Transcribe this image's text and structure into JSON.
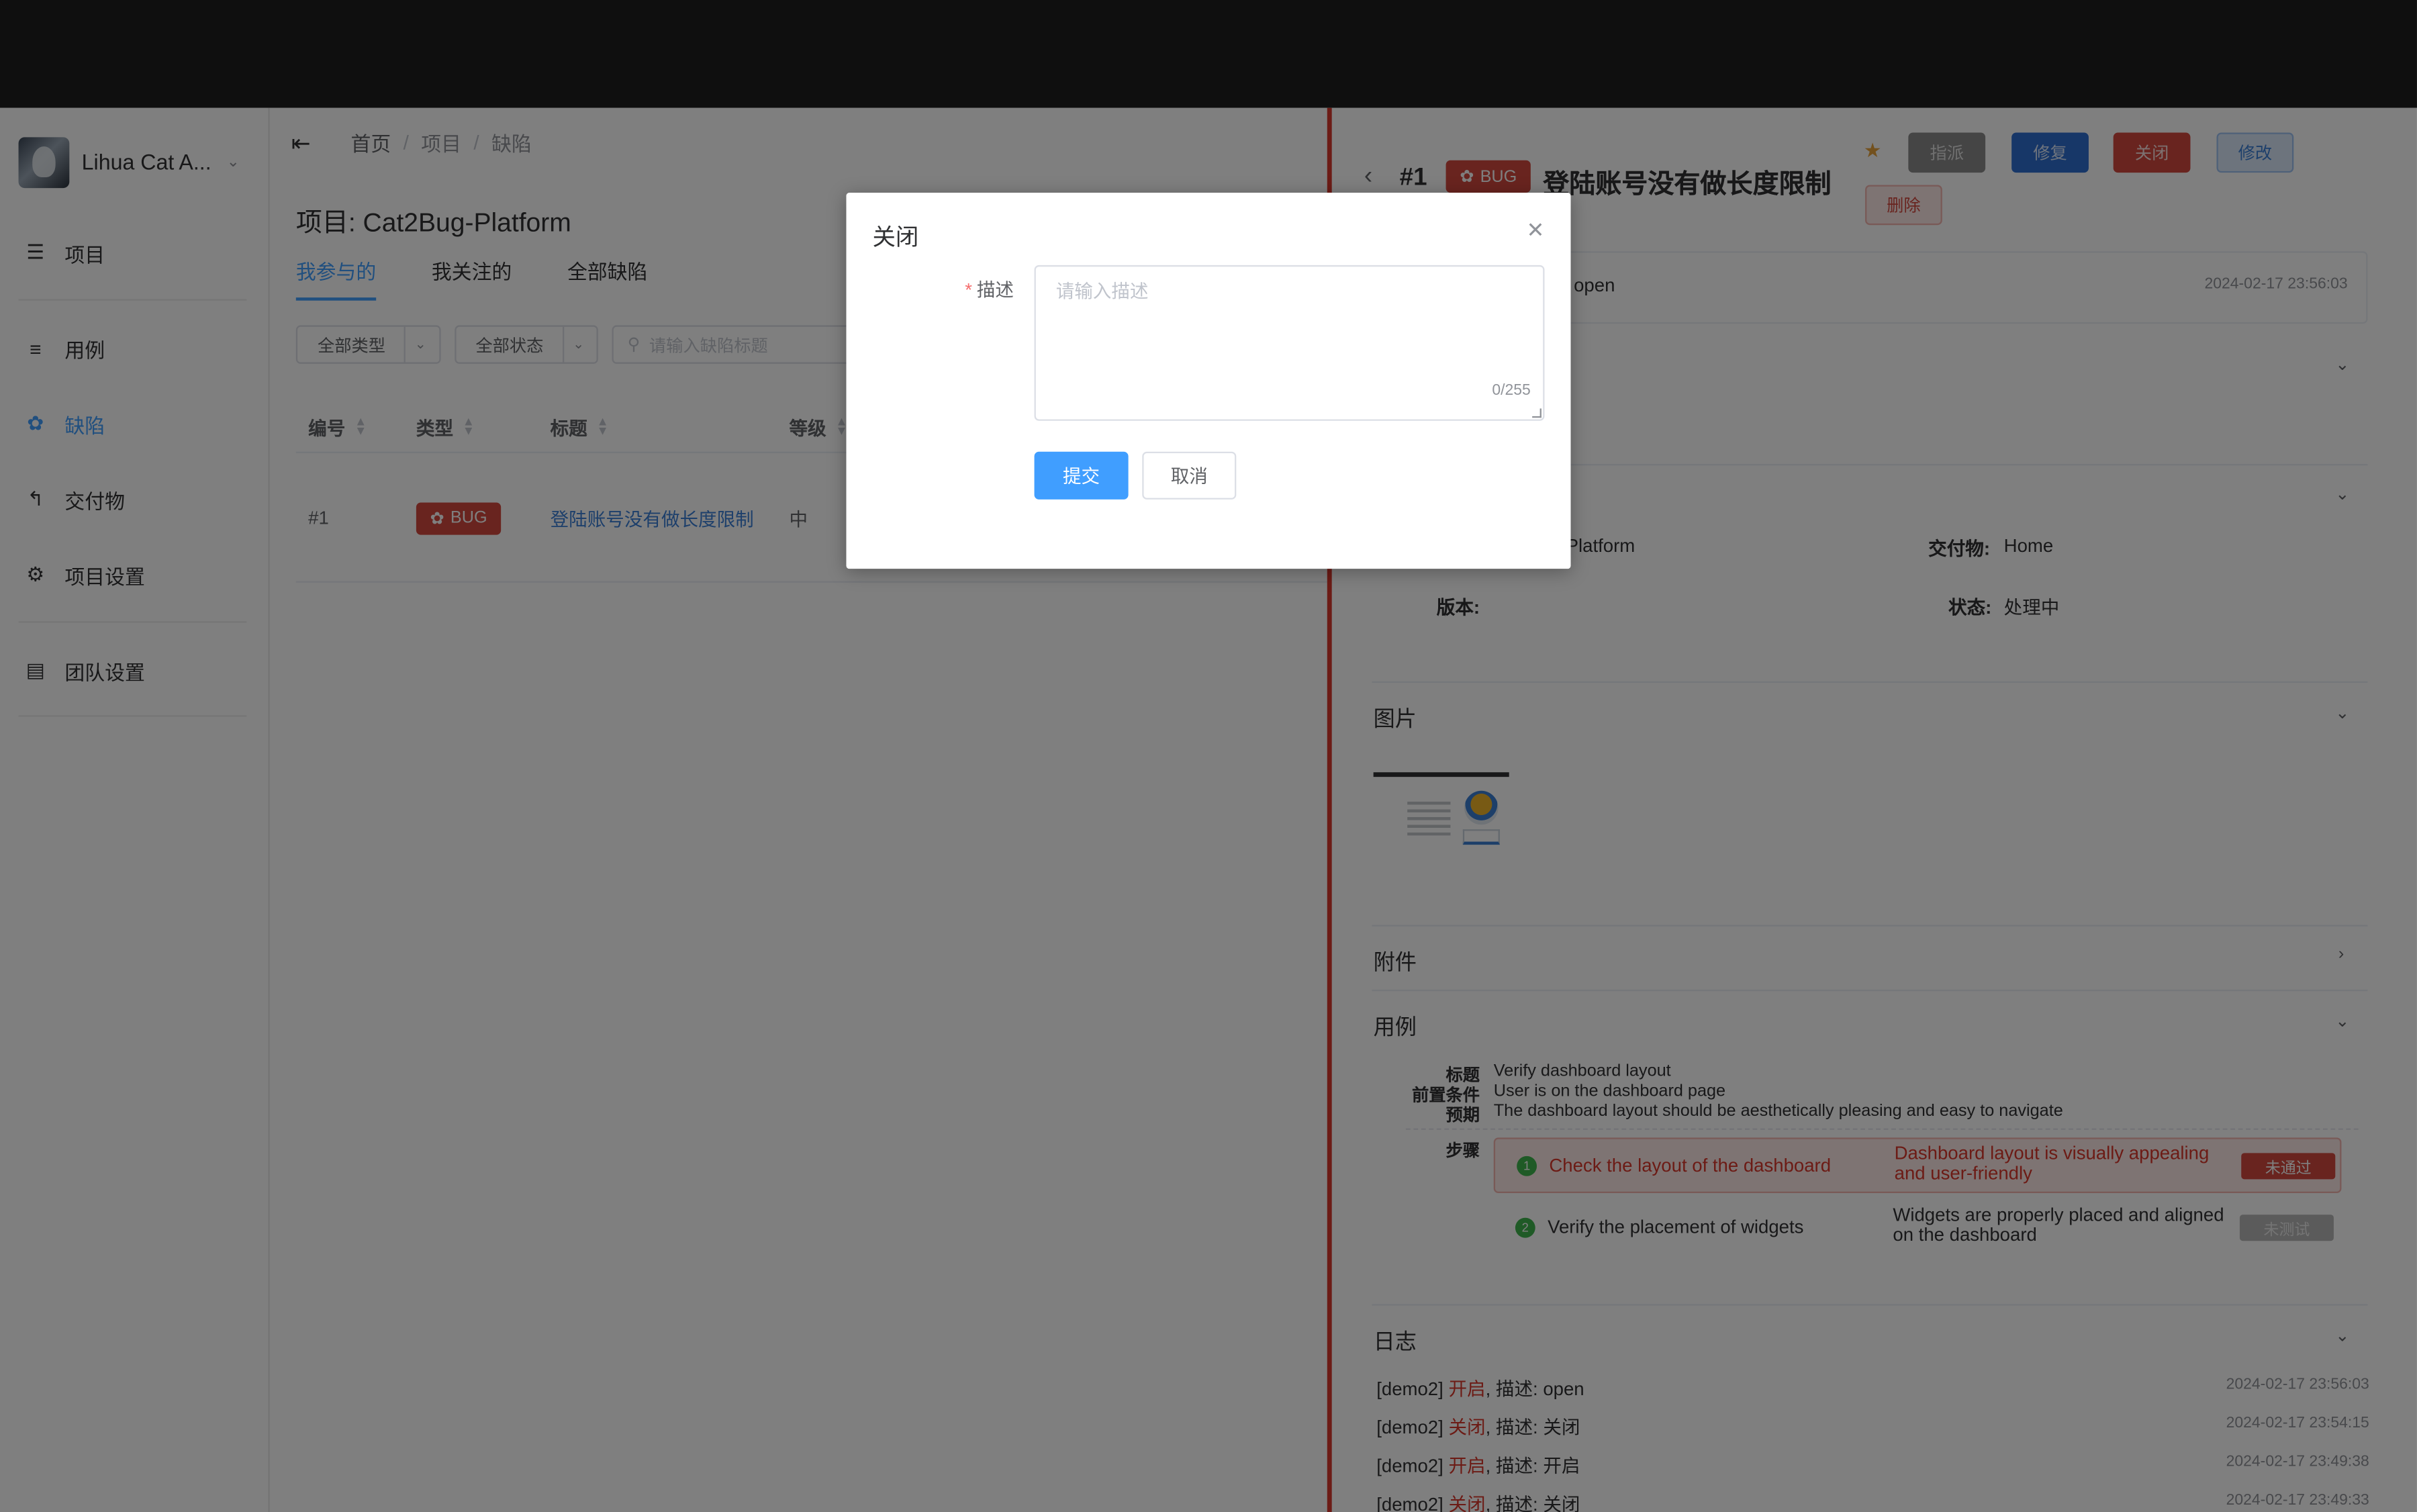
{
  "sidebar": {
    "org_name": "Lihua Cat A...",
    "items": [
      {
        "label": "项目",
        "icon": "list-icon"
      },
      {
        "label": "用例",
        "icon": "tree-list-icon"
      },
      {
        "label": "缺陷",
        "icon": "bug-icon"
      },
      {
        "label": "交付物",
        "icon": "deliverable-icon"
      },
      {
        "label": "项目设置",
        "icon": "gear-icon"
      },
      {
        "label": "团队设置",
        "icon": "team-doc-icon"
      }
    ],
    "active_index": 2
  },
  "breadcrumb": [
    "首页",
    "项目",
    "缺陷"
  ],
  "project_title": "项目: Cat2Bug-Platform",
  "tabs": [
    "我参与的",
    "我关注的",
    "全部缺陷"
  ],
  "filters": {
    "type_select": "全部类型",
    "status_select": "全部状态",
    "search_placeholder": "请输入缺陷标题"
  },
  "table": {
    "columns": [
      "编号",
      "类型",
      "标题",
      "等级"
    ],
    "rows": [
      {
        "id": "#1",
        "type": "BUG",
        "title": "登陆账号没有做长度限制",
        "level": "中"
      }
    ]
  },
  "detail": {
    "number": "#1",
    "type_tag": "BUG",
    "title": "登陆账号没有做长度限制",
    "actions": {
      "assign": "指派",
      "fix": "修复",
      "close": "关闭",
      "edit": "修改",
      "delete": "删除"
    },
    "status_note": "open",
    "status_time": "2024-02-17 23:56:03",
    "info": {
      "project_value": "Platform",
      "deliverable_label": "交付物:",
      "deliverable_value": "Home",
      "version_label": "版本:",
      "status_label": "状态:",
      "status_value": "处理中"
    },
    "sections": {
      "images": "图片",
      "attachments": "附件",
      "cases": "用例",
      "logs": "日志"
    },
    "case": {
      "title_label": "标题",
      "title_value": "Verify dashboard layout",
      "pre_label": "前置条件",
      "pre_value": "User is on the dashboard page",
      "expect_label": "预期",
      "expect_value": "The dashboard layout should be aesthetically pleasing and easy to navigate",
      "steps_label": "步骤",
      "steps": [
        {
          "num": "1",
          "name": "Check the layout of the dashboard",
          "expected": "Dashboard layout is visually appealing and user-friendly",
          "result": "未通过"
        },
        {
          "num": "2",
          "name": "Verify the placement of widgets",
          "expected": "Widgets are properly placed and aligned on the dashboard",
          "result": "未测试"
        }
      ]
    },
    "logs": [
      {
        "user": "[demo2]",
        "action": "开启",
        "desc": ", 描述: open",
        "time": "2024-02-17 23:56:03"
      },
      {
        "user": "[demo2]",
        "action": "关闭",
        "desc": ", 描述: 关闭",
        "time": "2024-02-17 23:54:15"
      },
      {
        "user": "[demo2]",
        "action": "开启",
        "desc": ", 描述: 开启",
        "time": "2024-02-17 23:49:38"
      },
      {
        "user": "[demo2]",
        "action": "关闭",
        "desc": ", 描述: 关闭",
        "time": "2024-02-17 23:49:33"
      }
    ]
  },
  "modal": {
    "title": "关闭",
    "field_label": "描述",
    "placeholder": "请输入描述",
    "counter": "0/255",
    "submit": "提交",
    "cancel": "取消"
  },
  "colors": {
    "primary": "#409eff",
    "danger": "#d2483f",
    "success": "#3fb54d",
    "star": "#e6a23c"
  }
}
